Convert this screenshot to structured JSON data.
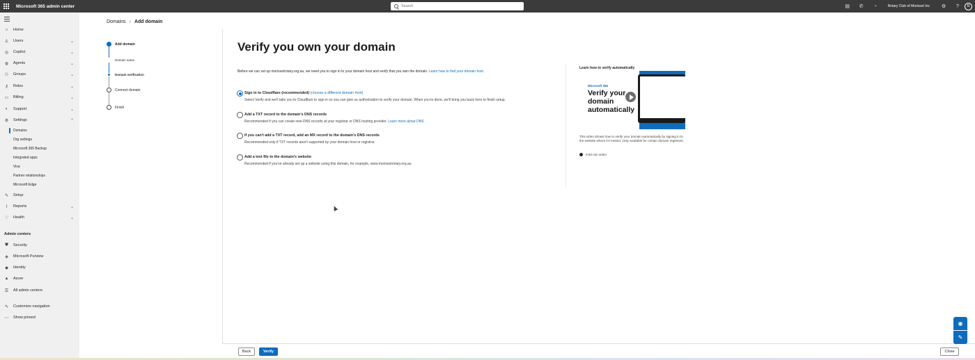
{
  "topbar": {
    "app_title": "Microsoft 365 admin center",
    "search_placeholder": "Search",
    "org_name": "Rotary Club of Morisset Inc",
    "avatar_initials": "R"
  },
  "nav": {
    "items": [
      {
        "label": "Home",
        "icon": "home-icon"
      },
      {
        "label": "Users",
        "icon": "person-icon"
      },
      {
        "label": "Copilot",
        "icon": "copilot-icon"
      },
      {
        "label": "Agents",
        "icon": "agents-icon"
      },
      {
        "label": "Groups",
        "icon": "groups-icon"
      },
      {
        "label": "Roles",
        "icon": "key-icon"
      },
      {
        "label": "Billing",
        "icon": "billing-icon"
      },
      {
        "label": "Support",
        "icon": "headset-icon"
      },
      {
        "label": "Settings",
        "icon": "gear-icon"
      }
    ],
    "settings_sub": [
      "Domains",
      "Org settings",
      "Microsoft 365 Backup",
      "Integrated apps",
      "Viva",
      "Partner relationships",
      "Microsoft Edge"
    ],
    "after_items": [
      {
        "label": "Setup",
        "icon": "wrench-icon"
      },
      {
        "label": "Reports",
        "icon": "chart-icon"
      },
      {
        "label": "Health",
        "icon": "heart-icon"
      }
    ],
    "admin_centers_label": "Admin centers",
    "admin_centers": [
      {
        "label": "Security",
        "icon": "shield-icon"
      },
      {
        "label": "Microsoft Purview",
        "icon": "purview-icon"
      },
      {
        "label": "Identity",
        "icon": "identity-icon"
      },
      {
        "label": "Azure",
        "icon": "azure-icon"
      },
      {
        "label": "All admin centers",
        "icon": "list-icon"
      }
    ],
    "customize": "Customize navigation",
    "show_pinned": "Show pinned"
  },
  "breadcrumb": {
    "parent": "Domains",
    "current": "Add domain"
  },
  "stepper": {
    "steps": [
      "Add domain",
      "Domain name",
      "Domain verification",
      "Connect domain",
      "Finish"
    ]
  },
  "main": {
    "title": "Verify you own your domain",
    "intro_text": "Before we can set up morissetrotary.org.au, we need you to sign in to your domain host and verify that you own the domain.",
    "intro_link": "Learn how to find your domain host",
    "options": [
      {
        "title": "Sign in to Cloudflare (recommended)",
        "title_link": "(choose a different domain host)",
        "desc": "Select Verify and we'll take you to Cloudflare to sign in so you can give us authorization to verify your domain. When you're done, we'll bring you back here to finish setup.",
        "desc_link": "",
        "checked": true
      },
      {
        "title": "Add a TXT record to the domain's DNS records",
        "title_link": "",
        "desc": "Recommended if you can create new DNS records at your registrar or DNS hosting provider.",
        "desc_link": "Learn more about DNS",
        "checked": false
      },
      {
        "title": "If you can't add a TXT record, add an MX record to the domain's DNS records",
        "title_link": "",
        "desc": "Recommended only if TXT records aren't supported by your domain host or registrar.",
        "desc_link": "",
        "checked": false
      },
      {
        "title": "Add a text file to the domain's website",
        "title_link": "",
        "desc": "Recommended if you've already set up a website using this domain, for example, www.morissetrotary.org.au",
        "desc_link": "",
        "checked": false
      }
    ]
  },
  "video": {
    "heading": "Learn how to verify automatically",
    "brand": "Microsoft 365",
    "big_text": "Verify your domain automatically",
    "caption": "This video shows how to verify your domain automatically by signing in to the website where it's hosted. Only available for certain domain registrars.",
    "duration": "0:53 min video"
  },
  "footer": {
    "back": "Back",
    "verify": "Verify",
    "close": "Close"
  }
}
